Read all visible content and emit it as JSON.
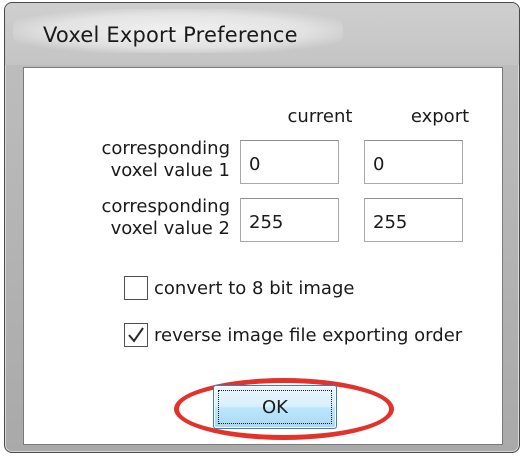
{
  "window": {
    "title": "Voxel Export Preference"
  },
  "columns": {
    "current": "current",
    "export": "export"
  },
  "rows": [
    {
      "label_line1": "corresponding",
      "label_line2": "voxel value 1",
      "current": "0",
      "export": "0"
    },
    {
      "label_line1": "corresponding",
      "label_line2": "voxel value 2",
      "current": "255",
      "export": "255"
    }
  ],
  "options": [
    {
      "label": "convert to 8 bit image",
      "checked": false
    },
    {
      "label": "reverse image file exporting order",
      "checked": true
    }
  ],
  "ok_button": {
    "label": "OK"
  },
  "highlight_color": "#e2322a"
}
